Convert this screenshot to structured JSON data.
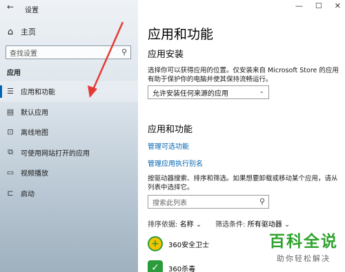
{
  "window": {
    "title": "设置",
    "controls": [
      "—",
      "☐",
      "✕"
    ]
  },
  "sidebar": {
    "home_label": "主页",
    "search_placeholder": "查找设置",
    "section_label": "应用",
    "items": [
      {
        "label": "应用和功能",
        "icon": "apps-features-icon",
        "glyph": "☰"
      },
      {
        "label": "默认应用",
        "icon": "default-apps-icon",
        "glyph": "▤"
      },
      {
        "label": "离线地图",
        "icon": "offline-maps-icon",
        "glyph": "⊡"
      },
      {
        "label": "可使用网站打开的应用",
        "icon": "apps-for-websites-icon",
        "glyph": "⧉"
      },
      {
        "label": "视频播放",
        "icon": "video-playback-icon",
        "glyph": "▭"
      },
      {
        "label": "启动",
        "icon": "startup-icon",
        "glyph": "⊏"
      }
    ]
  },
  "main": {
    "title": "应用和功能",
    "install": {
      "heading": "应用安装",
      "description": "选择你可以获得应用的位置。仅安装来自 Microsoft Store 的应用有助于保护你的电脑并使其保持流畅运行。",
      "dropdown_value": "允许安装任何来源的应用"
    },
    "apps": {
      "heading": "应用和功能",
      "link_optional": "管理可选功能",
      "link_alias": "管理应用执行别名",
      "description": "按驱动器搜索、排序和筛选。如果想要卸载或移动某个应用，请从列表中选择它。",
      "search_placeholder": "搜索此列表",
      "sort_label": "排序依据:",
      "sort_value": "名称",
      "filter_label": "筛选条件:",
      "filter_value": "所有驱动器",
      "list": [
        {
          "name": "360安全卫士",
          "icon": "360-safe-icon"
        },
        {
          "name": "360杀毒",
          "icon": "360-antivirus-icon"
        }
      ]
    }
  },
  "watermark": {
    "main": "百科全说",
    "sub": "助你轻松解决"
  },
  "colors": {
    "accent": "#0063b1",
    "arrow": "#e53935",
    "watermark": "#2ea32e"
  }
}
